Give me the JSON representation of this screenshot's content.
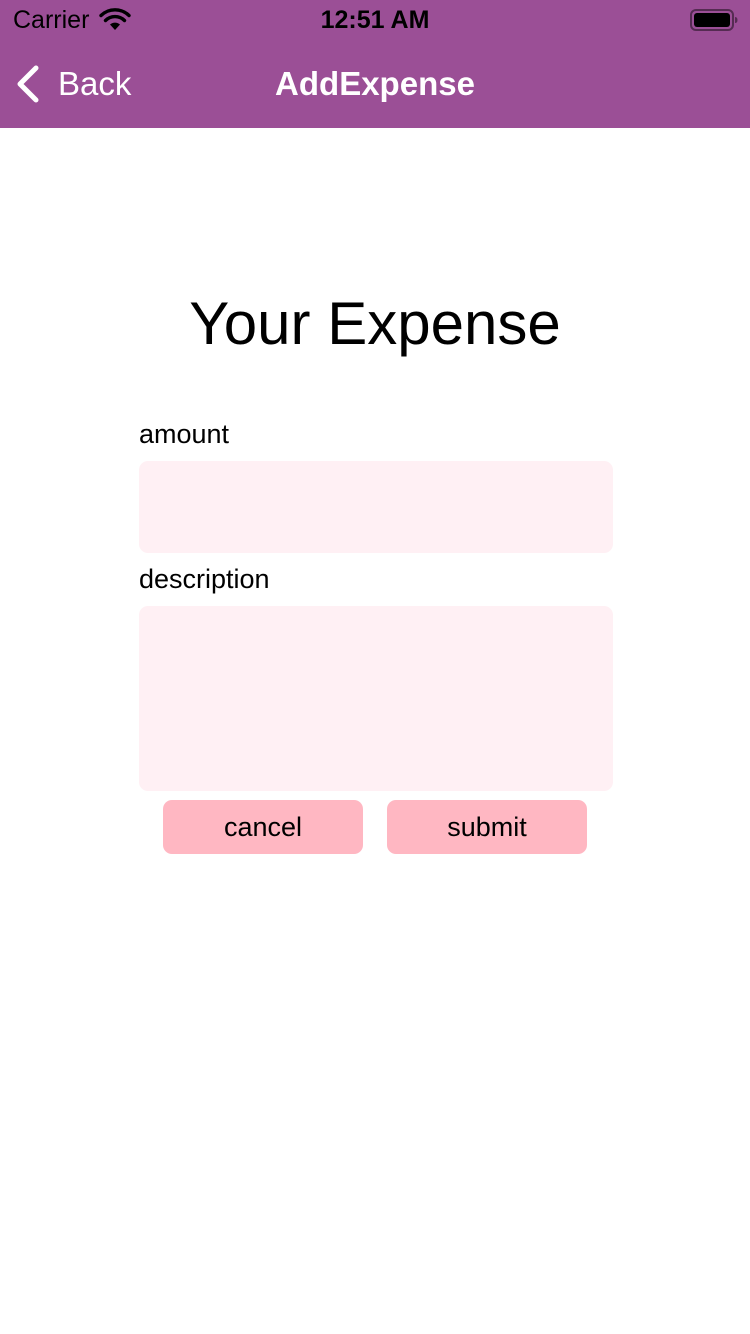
{
  "status_bar": {
    "carrier": "Carrier",
    "time": "12:51 AM",
    "icons": [
      "wifi-icon",
      "battery-icon"
    ]
  },
  "nav": {
    "back_label": "Back",
    "back_icon": "chevron-left-icon",
    "title": "AddExpense",
    "background_color": "#9b4f96"
  },
  "form": {
    "title": "Your Expense",
    "amount": {
      "label": "amount",
      "value": "",
      "placeholder": ""
    },
    "description": {
      "label": "description",
      "value": "",
      "placeholder": ""
    },
    "input_background_color": "#fff0f4"
  },
  "actions": {
    "cancel_label": "cancel",
    "submit_label": "submit",
    "button_color": "#ffb7c2"
  }
}
